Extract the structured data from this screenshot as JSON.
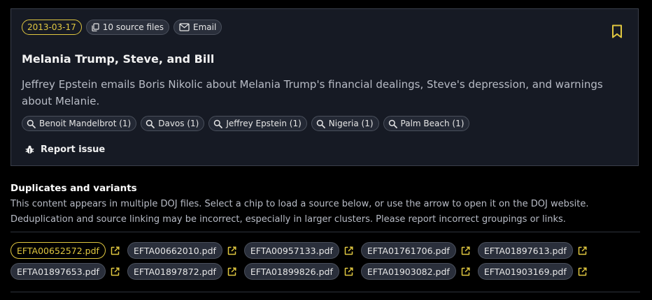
{
  "card": {
    "date": "2013-03-17",
    "source_files": "10 source files",
    "type": "Email",
    "title": "Melania Trump, Steve, and Bill",
    "summary": "Jeffrey Epstein emails Boris Nikolic about Melania Trump's financial dealings, Steve's depression, and warnings about Melanie.",
    "tags": [
      "Benoit Mandelbrot (1)",
      "Davos (1)",
      "Jeffrey Epstein (1)",
      "Nigeria (1)",
      "Palm Beach (1)"
    ],
    "report_label": "Report issue",
    "icons": {
      "source_files": "copy-icon",
      "type": "mail-icon",
      "bookmark": "bookmark-icon",
      "tag": "search-icon",
      "report": "bug-icon"
    }
  },
  "duplicates": {
    "heading": "Duplicates and variants",
    "description": "This content appears in multiple DOJ files. Select a chip to load a source below, or use the arrow to open it on the DOJ website. Deduplication and source linking may be incorrect, especially in larger clusters. Please report incorrect groupings or links.",
    "external_link_icon": "external-link-icon",
    "files": [
      "EFTA00652572.pdf",
      "EFTA00662010.pdf",
      "EFTA00957133.pdf",
      "EFTA01761706.pdf",
      "EFTA01897613.pdf",
      "EFTA01897653.pdf",
      "EFTA01897872.pdf",
      "EFTA01899826.pdf",
      "EFTA01903082.pdf",
      "EFTA01903169.pdf"
    ],
    "selected_index": 0
  },
  "colors": {
    "accent": "#e0c740",
    "card_bg": "#161a24",
    "page_bg": "#000000"
  }
}
